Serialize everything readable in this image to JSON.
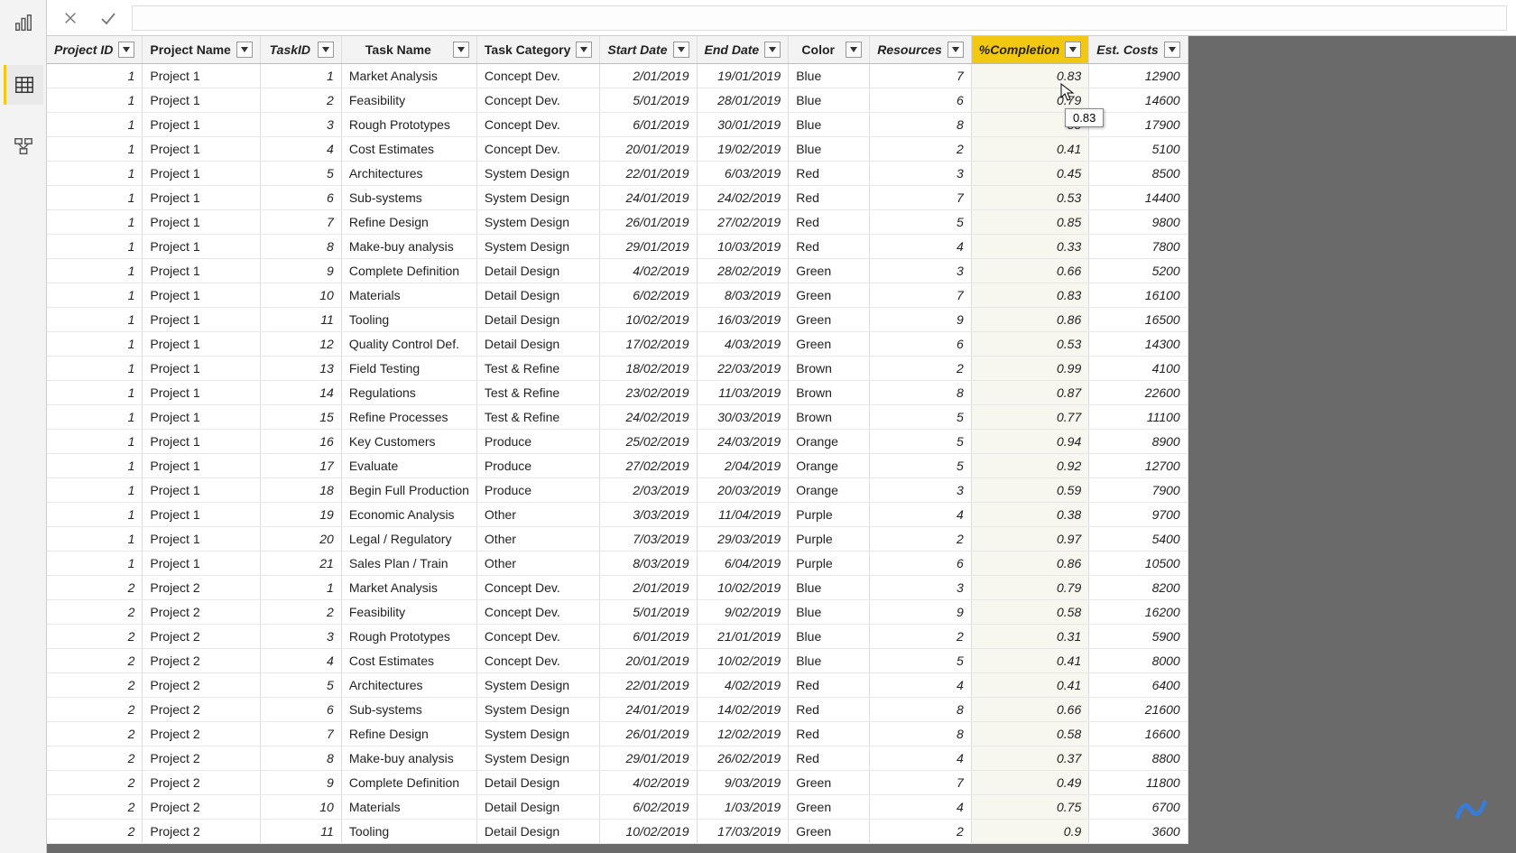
{
  "nav": {
    "report": "report-view",
    "data": "data-view",
    "model": "model-view"
  },
  "formula_bar": {
    "cancel": "×",
    "commit": "✓"
  },
  "tooltip": {
    "value": "0.83"
  },
  "columns": [
    {
      "key": "project_id",
      "label": "Project ID",
      "cls": "c-projid"
    },
    {
      "key": "project_name",
      "label": "Project Name",
      "cls": "c-projname"
    },
    {
      "key": "task_id",
      "label": "TaskID",
      "cls": "c-taskid"
    },
    {
      "key": "task_name",
      "label": "Task Name",
      "cls": "c-taskname"
    },
    {
      "key": "category",
      "label": "Task Category",
      "cls": "c-cat"
    },
    {
      "key": "start",
      "label": "Start Date",
      "cls": "c-start"
    },
    {
      "key": "end",
      "label": "End Date",
      "cls": "c-end"
    },
    {
      "key": "color",
      "label": "Color",
      "cls": "c-color"
    },
    {
      "key": "resources",
      "label": "Resources",
      "cls": "c-res"
    },
    {
      "key": "pct",
      "label": "%Completion",
      "cls": "c-pct",
      "selected": true
    },
    {
      "key": "cost",
      "label": "Est. Costs",
      "cls": "c-cost"
    }
  ],
  "rows": [
    {
      "project_id": "1",
      "project_name": "Project 1",
      "task_id": "1",
      "task_name": "Market Analysis",
      "category": "Concept Dev.",
      "start": "2/01/2019",
      "end": "19/01/2019",
      "color": "Blue",
      "resources": "7",
      "pct": "0.83",
      "cost": "12900"
    },
    {
      "project_id": "1",
      "project_name": "Project 1",
      "task_id": "2",
      "task_name": "Feasibility",
      "category": "Concept Dev.",
      "start": "5/01/2019",
      "end": "28/01/2019",
      "color": "Blue",
      "resources": "6",
      "pct": "0.79",
      "cost": "14600"
    },
    {
      "project_id": "1",
      "project_name": "Project 1",
      "task_id": "3",
      "task_name": "Rough Prototypes",
      "category": "Concept Dev.",
      "start": "6/01/2019",
      "end": "30/01/2019",
      "color": "Blue",
      "resources": "8",
      "pct": "55",
      "cost": "17900"
    },
    {
      "project_id": "1",
      "project_name": "Project 1",
      "task_id": "4",
      "task_name": "Cost Estimates",
      "category": "Concept Dev.",
      "start": "20/01/2019",
      "end": "19/02/2019",
      "color": "Blue",
      "resources": "2",
      "pct": "0.41",
      "cost": "5100"
    },
    {
      "project_id": "1",
      "project_name": "Project 1",
      "task_id": "5",
      "task_name": "Architectures",
      "category": "System Design",
      "start": "22/01/2019",
      "end": "6/03/2019",
      "color": "Red",
      "resources": "3",
      "pct": "0.45",
      "cost": "8500"
    },
    {
      "project_id": "1",
      "project_name": "Project 1",
      "task_id": "6",
      "task_name": "Sub-systems",
      "category": "System Design",
      "start": "24/01/2019",
      "end": "24/02/2019",
      "color": "Red",
      "resources": "7",
      "pct": "0.53",
      "cost": "14400"
    },
    {
      "project_id": "1",
      "project_name": "Project 1",
      "task_id": "7",
      "task_name": "Refine Design",
      "category": "System Design",
      "start": "26/01/2019",
      "end": "27/02/2019",
      "color": "Red",
      "resources": "5",
      "pct": "0.85",
      "cost": "9800"
    },
    {
      "project_id": "1",
      "project_name": "Project 1",
      "task_id": "8",
      "task_name": "Make-buy analysis",
      "category": "System Design",
      "start": "29/01/2019",
      "end": "10/03/2019",
      "color": "Red",
      "resources": "4",
      "pct": "0.33",
      "cost": "7800"
    },
    {
      "project_id": "1",
      "project_name": "Project 1",
      "task_id": "9",
      "task_name": "Complete Definition",
      "category": "Detail Design",
      "start": "4/02/2019",
      "end": "28/02/2019",
      "color": "Green",
      "resources": "3",
      "pct": "0.66",
      "cost": "5200"
    },
    {
      "project_id": "1",
      "project_name": "Project 1",
      "task_id": "10",
      "task_name": "Materials",
      "category": "Detail Design",
      "start": "6/02/2019",
      "end": "8/03/2019",
      "color": "Green",
      "resources": "7",
      "pct": "0.83",
      "cost": "16100"
    },
    {
      "project_id": "1",
      "project_name": "Project 1",
      "task_id": "11",
      "task_name": "Tooling",
      "category": "Detail Design",
      "start": "10/02/2019",
      "end": "16/03/2019",
      "color": "Green",
      "resources": "9",
      "pct": "0.86",
      "cost": "16500"
    },
    {
      "project_id": "1",
      "project_name": "Project 1",
      "task_id": "12",
      "task_name": "Quality Control Def.",
      "category": "Detail Design",
      "start": "17/02/2019",
      "end": "4/03/2019",
      "color": "Green",
      "resources": "6",
      "pct": "0.53",
      "cost": "14300"
    },
    {
      "project_id": "1",
      "project_name": "Project 1",
      "task_id": "13",
      "task_name": "Field Testing",
      "category": "Test & Refine",
      "start": "18/02/2019",
      "end": "22/03/2019",
      "color": "Brown",
      "resources": "2",
      "pct": "0.99",
      "cost": "4100"
    },
    {
      "project_id": "1",
      "project_name": "Project 1",
      "task_id": "14",
      "task_name": "Regulations",
      "category": "Test & Refine",
      "start": "23/02/2019",
      "end": "11/03/2019",
      "color": "Brown",
      "resources": "8",
      "pct": "0.87",
      "cost": "22600"
    },
    {
      "project_id": "1",
      "project_name": "Project 1",
      "task_id": "15",
      "task_name": "Refine Processes",
      "category": "Test & Refine",
      "start": "24/02/2019",
      "end": "30/03/2019",
      "color": "Brown",
      "resources": "5",
      "pct": "0.77",
      "cost": "11100"
    },
    {
      "project_id": "1",
      "project_name": "Project 1",
      "task_id": "16",
      "task_name": "Key Customers",
      "category": "Produce",
      "start": "25/02/2019",
      "end": "24/03/2019",
      "color": "Orange",
      "resources": "5",
      "pct": "0.94",
      "cost": "8900"
    },
    {
      "project_id": "1",
      "project_name": "Project 1",
      "task_id": "17",
      "task_name": "Evaluate",
      "category": "Produce",
      "start": "27/02/2019",
      "end": "2/04/2019",
      "color": "Orange",
      "resources": "5",
      "pct": "0.92",
      "cost": "12700"
    },
    {
      "project_id": "1",
      "project_name": "Project 1",
      "task_id": "18",
      "task_name": "Begin Full Production",
      "category": "Produce",
      "start": "2/03/2019",
      "end": "20/03/2019",
      "color": "Orange",
      "resources": "3",
      "pct": "0.59",
      "cost": "7900"
    },
    {
      "project_id": "1",
      "project_name": "Project 1",
      "task_id": "19",
      "task_name": "Economic Analysis",
      "category": "Other",
      "start": "3/03/2019",
      "end": "11/04/2019",
      "color": "Purple",
      "resources": "4",
      "pct": "0.38",
      "cost": "9700"
    },
    {
      "project_id": "1",
      "project_name": "Project 1",
      "task_id": "20",
      "task_name": "Legal / Regulatory",
      "category": "Other",
      "start": "7/03/2019",
      "end": "29/03/2019",
      "color": "Purple",
      "resources": "2",
      "pct": "0.97",
      "cost": "5400"
    },
    {
      "project_id": "1",
      "project_name": "Project 1",
      "task_id": "21",
      "task_name": "Sales Plan / Train",
      "category": "Other",
      "start": "8/03/2019",
      "end": "6/04/2019",
      "color": "Purple",
      "resources": "6",
      "pct": "0.86",
      "cost": "10500"
    },
    {
      "project_id": "2",
      "project_name": "Project 2",
      "task_id": "1",
      "task_name": "Market Analysis",
      "category": "Concept Dev.",
      "start": "2/01/2019",
      "end": "10/02/2019",
      "color": "Blue",
      "resources": "3",
      "pct": "0.79",
      "cost": "8200"
    },
    {
      "project_id": "2",
      "project_name": "Project 2",
      "task_id": "2",
      "task_name": "Feasibility",
      "category": "Concept Dev.",
      "start": "5/01/2019",
      "end": "9/02/2019",
      "color": "Blue",
      "resources": "9",
      "pct": "0.58",
      "cost": "16200"
    },
    {
      "project_id": "2",
      "project_name": "Project 2",
      "task_id": "3",
      "task_name": "Rough Prototypes",
      "category": "Concept Dev.",
      "start": "6/01/2019",
      "end": "21/01/2019",
      "color": "Blue",
      "resources": "2",
      "pct": "0.31",
      "cost": "5900"
    },
    {
      "project_id": "2",
      "project_name": "Project 2",
      "task_id": "4",
      "task_name": "Cost Estimates",
      "category": "Concept Dev.",
      "start": "20/01/2019",
      "end": "10/02/2019",
      "color": "Blue",
      "resources": "5",
      "pct": "0.41",
      "cost": "8000"
    },
    {
      "project_id": "2",
      "project_name": "Project 2",
      "task_id": "5",
      "task_name": "Architectures",
      "category": "System Design",
      "start": "22/01/2019",
      "end": "4/02/2019",
      "color": "Red",
      "resources": "4",
      "pct": "0.41",
      "cost": "6400"
    },
    {
      "project_id": "2",
      "project_name": "Project 2",
      "task_id": "6",
      "task_name": "Sub-systems",
      "category": "System Design",
      "start": "24/01/2019",
      "end": "14/02/2019",
      "color": "Red",
      "resources": "8",
      "pct": "0.66",
      "cost": "21600"
    },
    {
      "project_id": "2",
      "project_name": "Project 2",
      "task_id": "7",
      "task_name": "Refine Design",
      "category": "System Design",
      "start": "26/01/2019",
      "end": "12/02/2019",
      "color": "Red",
      "resources": "8",
      "pct": "0.58",
      "cost": "16600"
    },
    {
      "project_id": "2",
      "project_name": "Project 2",
      "task_id": "8",
      "task_name": "Make-buy analysis",
      "category": "System Design",
      "start": "29/01/2019",
      "end": "26/02/2019",
      "color": "Red",
      "resources": "4",
      "pct": "0.37",
      "cost": "8800"
    },
    {
      "project_id": "2",
      "project_name": "Project 2",
      "task_id": "9",
      "task_name": "Complete Definition",
      "category": "Detail Design",
      "start": "4/02/2019",
      "end": "9/03/2019",
      "color": "Green",
      "resources": "7",
      "pct": "0.49",
      "cost": "11800"
    },
    {
      "project_id": "2",
      "project_name": "Project 2",
      "task_id": "10",
      "task_name": "Materials",
      "category": "Detail Design",
      "start": "6/02/2019",
      "end": "1/03/2019",
      "color": "Green",
      "resources": "4",
      "pct": "0.75",
      "cost": "6700"
    },
    {
      "project_id": "2",
      "project_name": "Project 2",
      "task_id": "11",
      "task_name": "Tooling",
      "category": "Detail Design",
      "start": "10/02/2019",
      "end": "17/03/2019",
      "color": "Green",
      "resources": "2",
      "pct": "0.9",
      "cost": "3600"
    }
  ]
}
